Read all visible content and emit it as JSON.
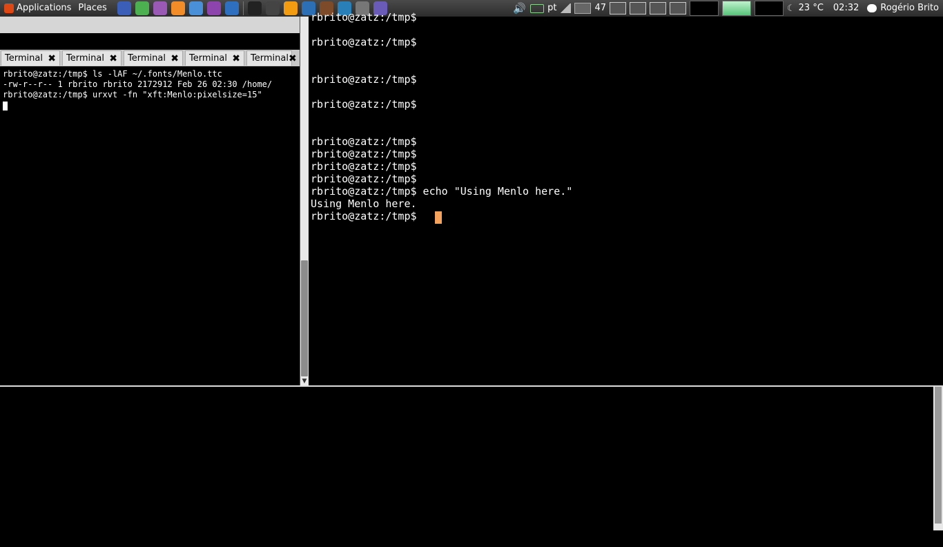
{
  "panel": {
    "applications_label": "Applications",
    "places_label": "Places",
    "launchers": [
      {
        "name": "browser-icon",
        "color": "#3b5fb8"
      },
      {
        "name": "tool-icon",
        "color": "#4caf50"
      },
      {
        "name": "chat-icon",
        "color": "#9b59b6"
      },
      {
        "name": "rss-icon",
        "color": "#f28c28"
      },
      {
        "name": "chromium-icon",
        "color": "#4a90d9"
      },
      {
        "name": "podcast-icon",
        "color": "#8e44ad"
      },
      {
        "name": "qbittorrent-icon",
        "color": "#2f6fbf"
      },
      {
        "name": "terminal-icon",
        "color": "#222"
      },
      {
        "name": "camera-icon",
        "color": "#444"
      },
      {
        "name": "vlc-icon",
        "color": "#f39c12"
      },
      {
        "name": "player-icon",
        "color": "#2c6fb5"
      },
      {
        "name": "game-icon",
        "color": "#7d4b2a"
      },
      {
        "name": "monitor-icon",
        "color": "#2980b9"
      },
      {
        "name": "disc-icon",
        "color": "#777"
      },
      {
        "name": "emacs-icon",
        "color": "#6b5bb8"
      }
    ],
    "keyboard_layout": "pt",
    "workspace_count": "47",
    "temperature": "23 °C",
    "clock": "02:32",
    "user": "Rogério Brito"
  },
  "left_terminal": {
    "tabs": [
      "Terminal",
      "Terminal",
      "Terminal",
      "Terminal",
      "Terminal"
    ],
    "lines": [
      "rbrito@zatz:/tmp$ ls -lAF ~/.fonts/Menlo.ttc",
      "-rw-r--r-- 1 rbrito rbrito 2172912 Feb 26 02:30 /home/",
      "rbrito@zatz:/tmp$ urxvt -fn \"xft:Menlo:pixelsize=15\""
    ]
  },
  "right_terminal": {
    "lines": [
      "rbrito@zatz:/tmp$",
      "rbrito@zatz:/tmp$",
      "rbrito@zatz:/tmp$",
      "rbrito@zatz:/tmp$",
      "rbrito@zatz:/tmp$",
      "rbrito@zatz:/tmp$",
      "rbrito@zatz:/tmp$",
      "rbrito@zatz:/tmp$",
      "rbrito@zatz:/tmp$ echo \"Using Menlo here.\"",
      "Using Menlo here.",
      "rbrito@zatz:/tmp$"
    ]
  },
  "colors": {
    "cursor": "#f5a25d",
    "terminal_bg": "#000000",
    "terminal_fg": "#ffffff"
  }
}
